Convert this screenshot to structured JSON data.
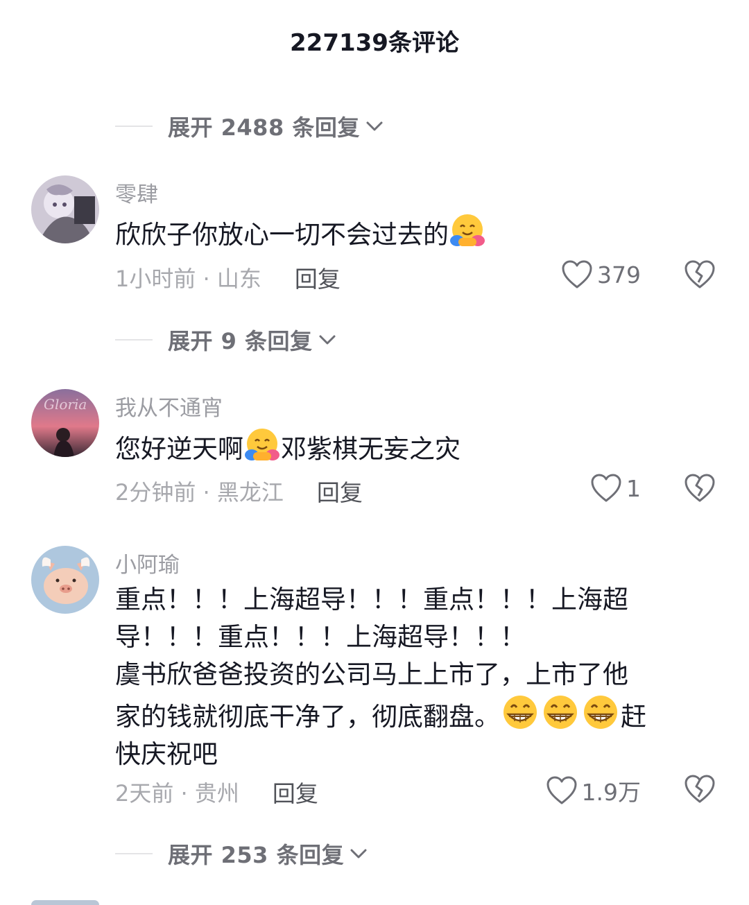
{
  "header": {
    "title": "227139条评论"
  },
  "expanders": [
    {
      "label": "展开 2488 条回复"
    },
    {
      "label": "展开 9 条回复"
    },
    {
      "label": "展开 253 条回复"
    }
  ],
  "comments": [
    {
      "username": "零肆",
      "text": "欣欣子你放心一切不会过去的",
      "emoji": "hugging-face",
      "time_location": "1小时前 · 山东",
      "reply_label": "回复",
      "likes": "379"
    },
    {
      "username": "我从不通宵",
      "text_before": "您好逆天啊",
      "text_after": "邓紫棋无妄之灾",
      "emoji": "hugging-face",
      "avatar_text": "Gloria",
      "time_location": "2分钟前 · 黑龙江",
      "reply_label": "回复",
      "likes": "1"
    },
    {
      "username": "小阿瑜",
      "line1": "重点！！！上海超导！！！重点！！！上海超",
      "line2": "导！！！重点！！！上海超导！！！",
      "line3": "虞书欣爸爸投资的公司马上上市了，上市了他",
      "line4_before": "家的钱就彻底干净了，彻底翻盘。",
      "line4_after": "赶",
      "line5": "快庆祝吧",
      "emoji": "grinning-face",
      "time_location": "2天前 · 贵州",
      "reply_label": "回复",
      "likes": "1.9万"
    }
  ],
  "colors": {
    "text_primary": "#161823",
    "text_secondary": "#9b9ca2",
    "meta": "#a7a8ad",
    "divider": "#e4e4e6"
  }
}
